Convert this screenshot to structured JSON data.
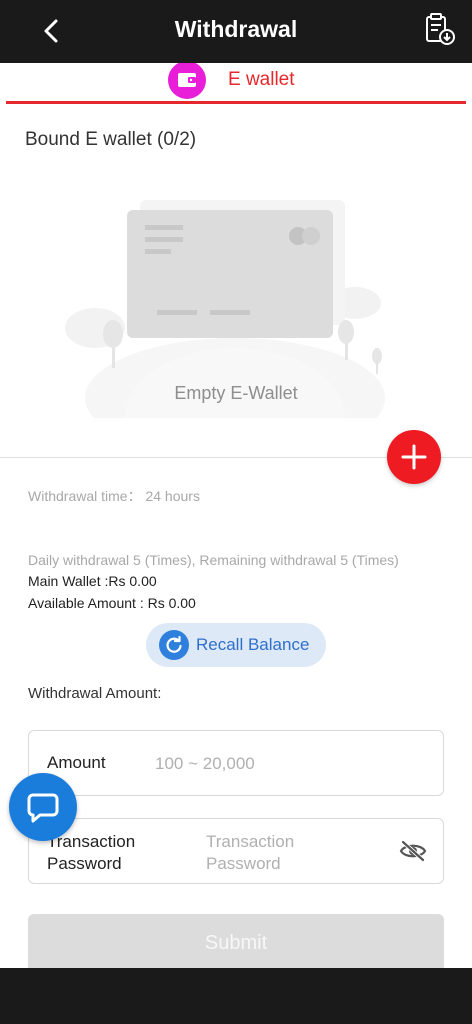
{
  "header": {
    "title": "Withdrawal",
    "back_icon": "chevron-left-icon",
    "records_icon": "clipboard-download-icon"
  },
  "tab": {
    "label": "E wallet",
    "icon": "wallet-icon",
    "accent": "#e5282b",
    "icon_color": "#e81ed8"
  },
  "wallet": {
    "bound_title": "Bound E wallet (0/2)",
    "empty_text": "Empty E-Wallet",
    "add_icon": "plus-icon"
  },
  "info": {
    "withdrawal_time": "Withdrawal time：  24 hours",
    "daily": "Daily withdrawal 5 (Times), Remaining withdrawal 5 (Times)",
    "main_wallet": "Main Wallet :Rs 0.00",
    "available": "Available Amount : Rs 0.00"
  },
  "recall": {
    "label": "Recall Balance",
    "icon": "refresh-icon"
  },
  "form": {
    "withdrawal_amount_label": "Withdrawal Amount:",
    "amount_label": "Amount",
    "amount_placeholder": "100 ~ 20,000",
    "password_label": "Transaction Password",
    "password_placeholder": "Transaction Password",
    "eye_icon": "eye-off-icon"
  },
  "submit": {
    "label": "Submit"
  },
  "chat": {
    "icon": "chat-bubble-icon"
  }
}
